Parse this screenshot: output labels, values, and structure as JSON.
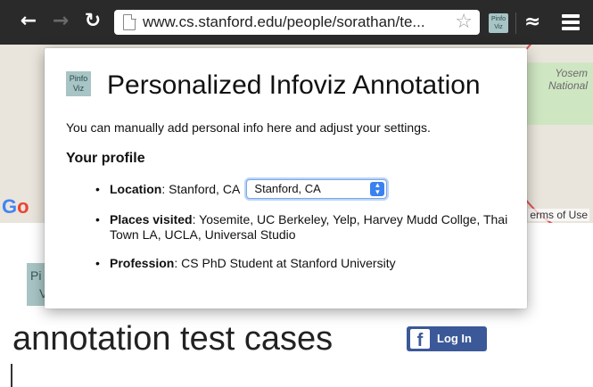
{
  "browser": {
    "url": "www.cs.stanford.edu/people/sorathan/te...",
    "extension_label_line1": "Pinfo",
    "extension_label_line2": "Viz"
  },
  "icons": {
    "back": "back-arrow-icon",
    "forward": "forward-arrow-icon",
    "reload": "reload-icon",
    "page": "page-icon",
    "star": "star-icon",
    "extension": "pinfoviz-extension-icon",
    "waves": "waves-icon",
    "menu": "hamburger-menu-icon"
  },
  "page": {
    "map_label_line1": "Yosem",
    "map_label_line2": "National",
    "map_terms": "erms of Use",
    "google_logo_g": "G",
    "google_logo_o": "o",
    "pinfo_badge_line1": "Pi",
    "pinfo_badge_line2": "V",
    "heading": "annotation test cases",
    "fb_icon": "f",
    "fb_login_label": "Log In"
  },
  "popup": {
    "logo_line1": "Pinfo",
    "logo_line2": "Viz",
    "title": "Personalized Infoviz Annotation",
    "description": "You can manually add personal info here and adjust your settings.",
    "profile_heading": "Your profile",
    "location": {
      "label": "Location",
      "value": "Stanford, CA",
      "select_value": "Stanford, CA"
    },
    "places_visited": {
      "label": "Places visited",
      "value": "Yosemite, UC Berkeley, Yelp, Harvey Mudd Collge, Thai Town LA, UCLA, Universal Studio"
    },
    "profession": {
      "label": "Profession",
      "value": "CS PhD Student at Stanford University"
    }
  },
  "colors": {
    "toolbar": "#2a2a2a",
    "pinfo_badge": "#a8c4c4",
    "facebook": "#3b5998",
    "select_accent": "#3b82f0"
  }
}
